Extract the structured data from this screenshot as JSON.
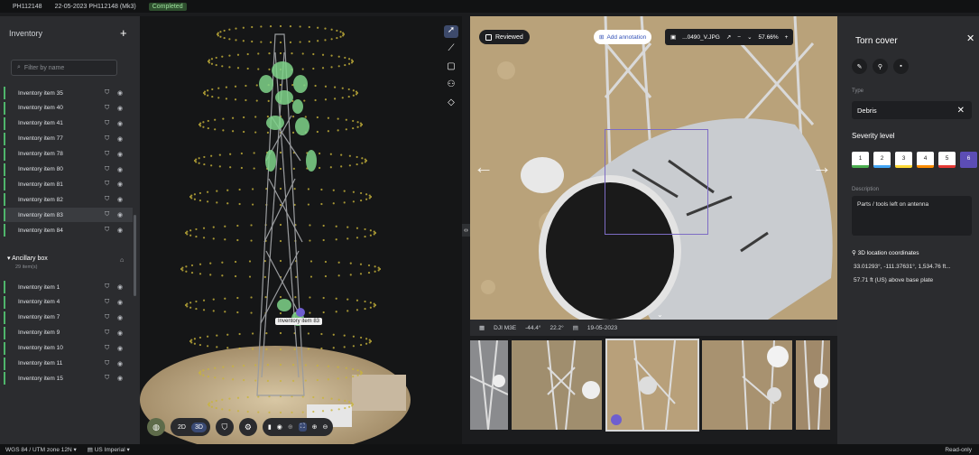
{
  "topbar": {
    "project_id": "PH112148",
    "session": "22-05-2023 PH112148 (Mk3)",
    "status": "Completed"
  },
  "inventory": {
    "title": "Inventory",
    "add_label": "+",
    "filter_placeholder": "Filter by name",
    "items": [
      "Inventory item 35",
      "Inventory item 40",
      "Inventory item 41",
      "Inventory item 77",
      "Inventory item 78",
      "Inventory item 80",
      "Inventory item 81",
      "Inventory item 82",
      "Inventory item 83",
      "Inventory item 84"
    ],
    "group": {
      "name": "Ancillary box",
      "count": "29 item(s)"
    },
    "group_items": [
      "Inventory item 1",
      "Inventory item 4",
      "Inventory item 7",
      "Inventory item 9",
      "Inventory item 10",
      "Inventory item 11",
      "Inventory item 15"
    ]
  },
  "viewer3d": {
    "tower_label": "Inventory item 83",
    "mode_2d": "2D",
    "mode_3d": "3D"
  },
  "photo": {
    "reviewed_label": "Reviewed",
    "add_annotation_label": "Add annotation",
    "filename": "...0490_V.JPG",
    "zoom": "57.66%",
    "zoom_minus": "−",
    "zoom_plus": "+",
    "camera": "DJI M3E",
    "pitch": "-44.4°",
    "heading": "22.2°",
    "date": "19-05-2023"
  },
  "panel": {
    "title": "Torn cover",
    "type_label": "Type",
    "type_value": "Debris",
    "severity_label": "Severity level",
    "severity_levels": [
      "1",
      "2",
      "3",
      "4",
      "5",
      "6"
    ],
    "severity_colors": [
      "#4caf50",
      "#42a5f5",
      "#fdd835",
      "#fb8c00",
      "#e53935",
      "#5c4db5"
    ],
    "description_label": "Description",
    "description_value": "Parts / tools left on antenna",
    "location_label": "3D location coordinates",
    "coordinates": "33.01293°, -111.37631°, 1,534.76 ft...",
    "elevation": "57.71 ft (US) above base plate"
  },
  "status": {
    "crs": "WGS 84 / UTM zone 12N",
    "units": "US Imperial",
    "mode": "Read-only"
  }
}
